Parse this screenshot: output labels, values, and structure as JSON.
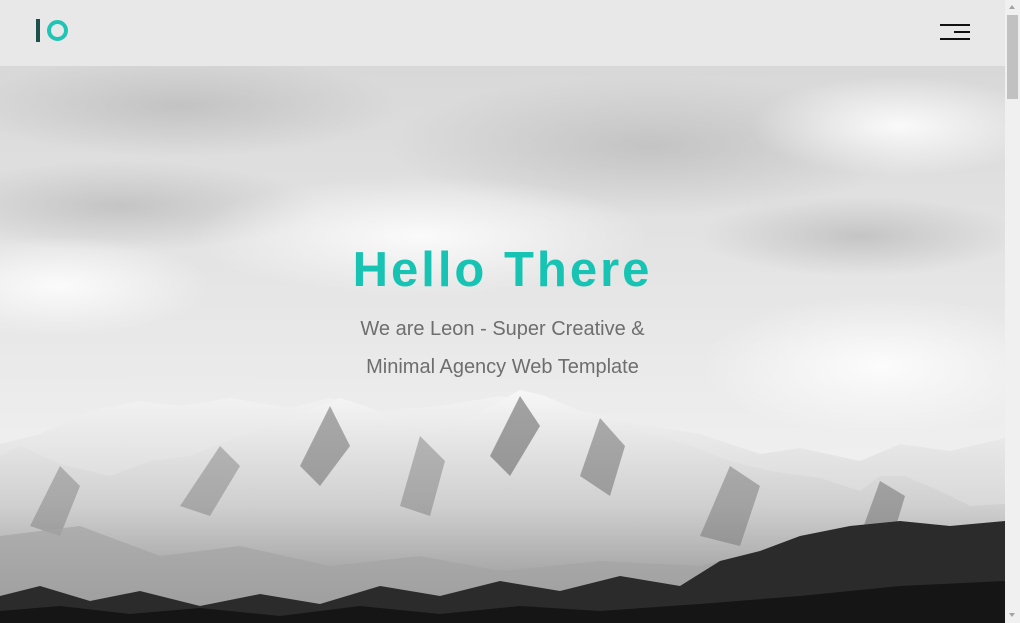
{
  "header": {
    "logo_name": "logo-mark",
    "menu_icon": "hamburger-menu-icon"
  },
  "hero": {
    "title": "Hello There",
    "subtitle_line1": "We are Leon - Super Creative &",
    "subtitle_line2": "Minimal Agency Web Template",
    "background": "snowy-mountains-photo"
  },
  "colors": {
    "accent": "#17c3b2",
    "logo_dark": "#1d4f4c",
    "header_bg": "#e8e8e8",
    "subtitle": "#6e6e6e"
  }
}
